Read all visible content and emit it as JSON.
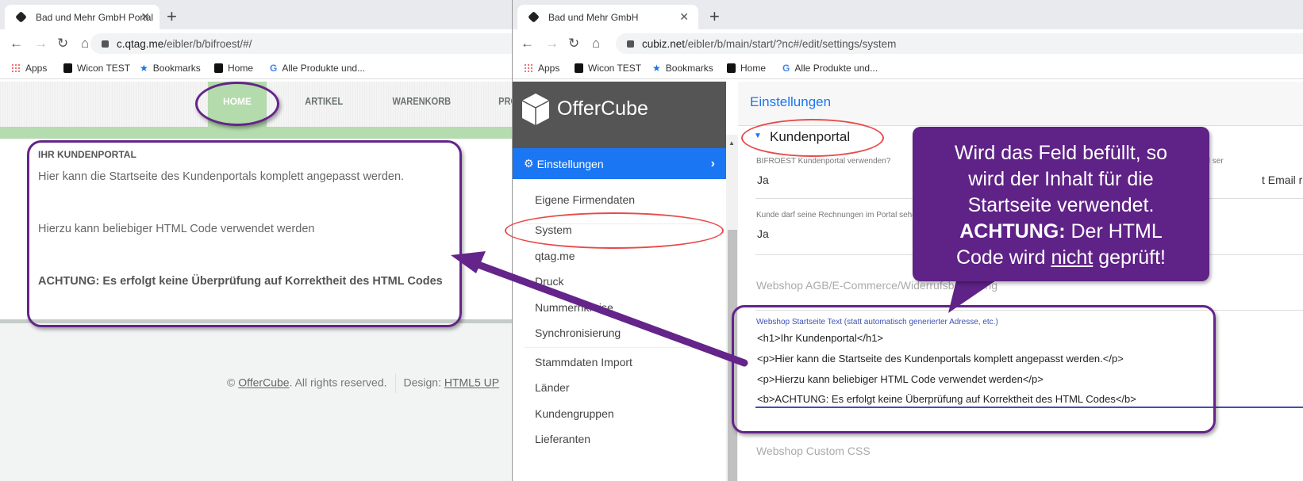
{
  "left_browser": {
    "tab_title": "Bad und Mehr GmbH Portal",
    "url_host": "c.qtag.me",
    "url_path": "/eibler/b/bifroest/#/",
    "bookmarks": [
      "Apps",
      "Wicon TEST",
      "Bookmarks",
      "Home",
      "Alle Produkte und..."
    ],
    "nav": [
      "HOME",
      "ARTIKEL",
      "WARENKORB",
      "PRO"
    ],
    "content": {
      "heading": "IHR KUNDENPORTAL",
      "p1": "Hier kann die Startseite des Kundenportals komplett angepasst werden.",
      "p2": "Hierzu kann beliebiger HTML Code verwendet werden",
      "warning": "ACHTUNG: Es erfolgt keine Überprüfung auf Korrektheit des HTML Codes"
    },
    "footer": {
      "copy": "©",
      "brand": "OfferCube",
      "rights": ". All rights reserved.",
      "design_label": "Design:",
      "design_link": "HTML5 UP"
    }
  },
  "right_browser": {
    "tab_title": "Bad und Mehr GmbH",
    "url_host": "cubiz.net",
    "url_path": "/eibler/b/main/start/?nc#/edit/settings/system",
    "bookmarks": [
      "Apps",
      "Wicon TEST",
      "Bookmarks",
      "Home",
      "Alle Produkte und..."
    ],
    "app_name": "OfferCube",
    "sidebar": {
      "active": "Einstellungen",
      "items": [
        "Eigene Firmendaten",
        "System",
        "qtag.me",
        "Druck",
        "Nummernkreise",
        "Synchronisierung",
        "Stammdaten Import",
        "Länder",
        "Kundengruppen",
        "Lieferanten"
      ]
    },
    "main": {
      "title": "Einstellungen",
      "section": "Kundenportal",
      "f1_label": "BIFROEST Kundenportal verwenden?",
      "f1_value": "Ja",
      "f2_label": "Kunde darf seine Rechnungen im Portal sehen",
      "f2_value": "Ja",
      "f3_label": "Email ser",
      "f3_value": "t Email r",
      "agb": "Webshop AGB/E-Commerce/Widerrufsbelehrung",
      "start_label": "Webshop Startseite Text (statt automatisch generierter Adresse, etc.)",
      "start_lines": [
        "<h1>Ihr Kundenportal</h1>",
        "<p>Hier kann die Startseite des Kundenportals komplett angepasst werden.</p>",
        "<p>Hierzu kann beliebiger HTML Code verwendet werden</p>",
        "<b>ACHTUNG: Es erfolgt keine Überprüfung auf Korrektheit des HTML Codes</b>"
      ],
      "css": "Webshop Custom CSS"
    }
  },
  "callout": {
    "line1": "Wird das Feld befüllt, so",
    "line2": "wird der Inhalt für die",
    "line3": "Startseite verwendet.",
    "bold": "ACHTUNG:",
    "line4": " Der HTML",
    "line5a": "Code wird ",
    "under": "nicht",
    "line5b": " geprüft!"
  },
  "colors": {
    "annotation_purple": "#64248a",
    "highlight_red": "#e84a4a",
    "accent_blue": "#1a76f2",
    "nav_green": "#b4dcae"
  }
}
